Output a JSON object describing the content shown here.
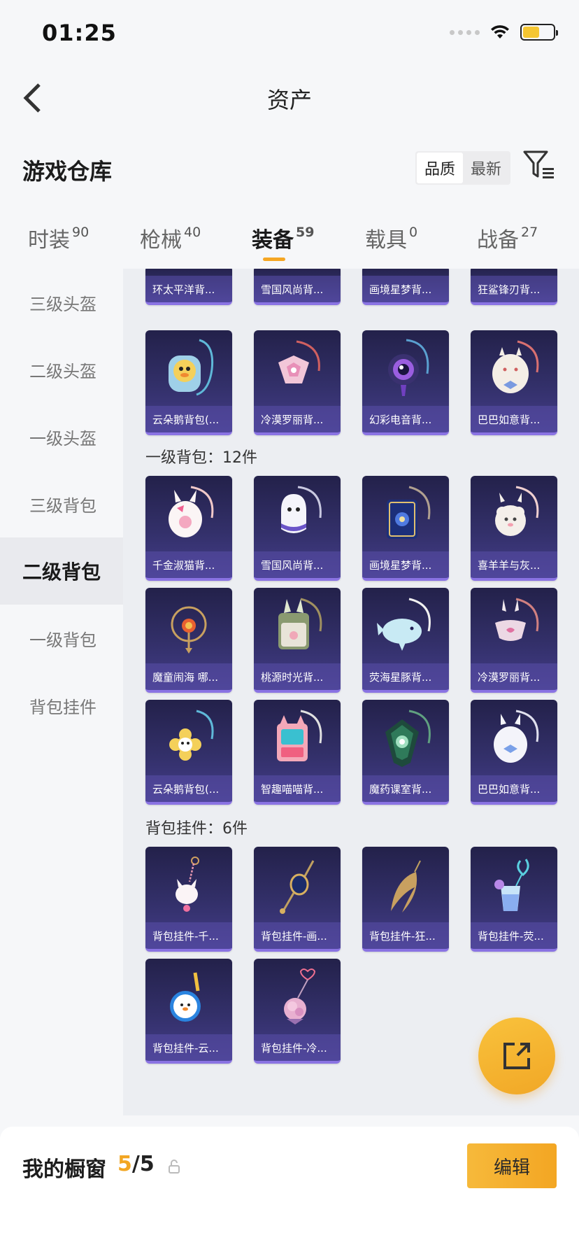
{
  "status_bar": {
    "time": "01:25",
    "battery_level": 0.55
  },
  "nav": {
    "title": "资产"
  },
  "warehouse": {
    "title": "游戏仓库",
    "sort_options": [
      "品质",
      "最新"
    ],
    "sort_active": "品质"
  },
  "tabs": [
    {
      "label": "时装",
      "count": "90"
    },
    {
      "label": "枪械",
      "count": "40"
    },
    {
      "label": "装备",
      "count": "59",
      "active": true
    },
    {
      "label": "载具",
      "count": "0"
    },
    {
      "label": "战备",
      "count": "27"
    }
  ],
  "sidebar": {
    "items": [
      "三级头盔",
      "二级头盔",
      "一级头盔",
      "三级背包",
      "二级背包",
      "一级背包",
      "背包挂件"
    ],
    "active": "二级背包"
  },
  "sections": [
    {
      "label": "",
      "items": [
        "环太平洋背...",
        "雪国风尚背...",
        "画境星梦背...",
        "狂鲨锋刃背...",
        "云朵鹅背包(...",
        "冷漠罗丽背...",
        "幻彩电音背...",
        "巴巴如意背..."
      ]
    },
    {
      "label": "一级背包：12件",
      "items": [
        "千金淑猫背...",
        "雪国风尚背...",
        "画境星梦背...",
        "喜羊羊与灰...",
        "魔童闹海 哪...",
        "桃源时光背...",
        "荧海星豚背...",
        "冷漠罗丽背...",
        "云朵鹅背包(...",
        "智趣喵喵背...",
        "魔药课室背...",
        "巴巴如意背..."
      ]
    },
    {
      "label": "背包挂件：6件",
      "items": [
        "背包挂件-千...",
        "背包挂件-画...",
        "背包挂件-狂...",
        "背包挂件-荧...",
        "背包挂件-云...",
        "背包挂件-冷..."
      ]
    }
  ],
  "showcase": {
    "title": "我的橱窗",
    "current": "5",
    "total": "/5",
    "edit_label": "编辑"
  },
  "colors": {
    "accent": "#f5a623",
    "card_bg": "#2e2b63",
    "card_border": "#8a73e3"
  }
}
